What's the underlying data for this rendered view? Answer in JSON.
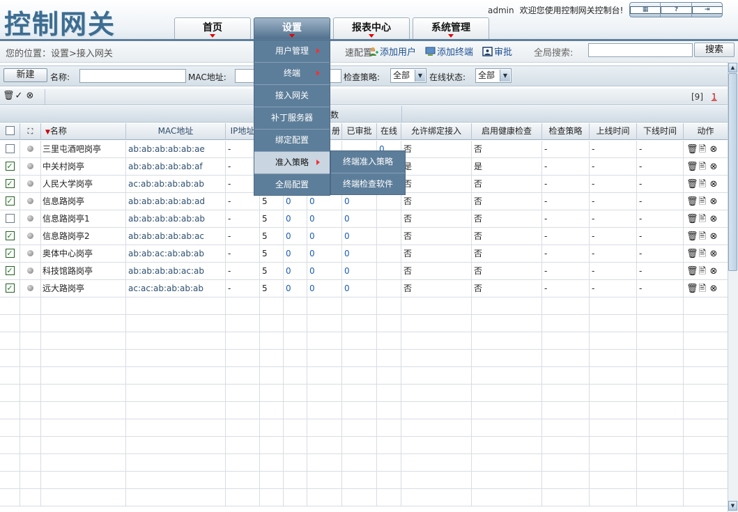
{
  "app": {
    "logo": "控制网关",
    "user": "admin",
    "welcome": "欢迎您使用控制网关控制台!"
  },
  "nav": {
    "tabs": [
      {
        "label": "首页"
      },
      {
        "label": "设置"
      },
      {
        "label": "报表中心"
      },
      {
        "label": "系统管理"
      }
    ]
  },
  "breadcrumb": "您的位置：设置>接入网关",
  "quick": {
    "label": "快速配置：",
    "label_visible": "速配置：",
    "add_user": "添加用户",
    "add_terminal": "添加终端",
    "approve": "审批"
  },
  "search": {
    "label": "全局搜索:",
    "value": "",
    "button": "搜索"
  },
  "filter": {
    "new_button": "新建",
    "name_label": "名称:",
    "mac_label": "MAC地址:",
    "check_policy_label": "检查策略:",
    "check_policy_value": "全部",
    "online_label": "在线状态:",
    "online_value": "全部"
  },
  "pager": {
    "count": "[9]",
    "page": "1"
  },
  "table": {
    "group_label": "端数",
    "columns": [
      "名称",
      "MAC地址",
      "IP地址",
      "",
      "",
      "",
      "册",
      "已审批",
      "在线",
      "允许绑定接入",
      "启用健康检查",
      "检查策略",
      "上线时间",
      "下线时间",
      "动作"
    ],
    "rows": [
      {
        "checked": false,
        "name": "三里屯酒吧岗亭",
        "mac": "ab:ab:ab:ab:ab:ae",
        "ip": "-",
        "a": "",
        "b": "",
        "c": "",
        "reg": "",
        "appr": "",
        "online": "0",
        "bind": "否",
        "health": "否",
        "policy": "-",
        "up": "-",
        "down": "-"
      },
      {
        "checked": true,
        "name": "中关村岗亭",
        "mac": "ab:ab:ab:ab:ab:af",
        "ip": "-",
        "a": "",
        "b": "",
        "c": "",
        "reg": "",
        "appr": "",
        "online": "",
        "bind": "是",
        "health": "是",
        "policy": "-",
        "up": "-",
        "down": "-"
      },
      {
        "checked": true,
        "name": "人民大学岗亭",
        "mac": "ac:ab:ab:ab:ab:ab",
        "ip": "-",
        "a": "",
        "b": "",
        "c": "",
        "reg": "",
        "appr": "",
        "online": "",
        "bind": "否",
        "health": "否",
        "policy": "-",
        "up": "-",
        "down": "-"
      },
      {
        "checked": true,
        "name": "信息路岗亭",
        "mac": "ab:ab:ab:ab:ab:ad",
        "ip": "-",
        "a": "5",
        "b": "0",
        "c": "0",
        "reg": "0",
        "appr": "0",
        "online": "",
        "bind": "否",
        "health": "否",
        "policy": "-",
        "up": "-",
        "down": "-"
      },
      {
        "checked": false,
        "name": "信息路岗亭1",
        "mac": "ab:ab:ab:ab:ab:ab",
        "ip": "-",
        "a": "5",
        "b": "0",
        "c": "0",
        "reg": "0",
        "appr": "0",
        "online": "",
        "bind": "否",
        "health": "否",
        "policy": "-",
        "up": "-",
        "down": "-"
      },
      {
        "checked": true,
        "name": "信息路岗亭2",
        "mac": "ab:ab:ab:ab:ab:ac",
        "ip": "-",
        "a": "5",
        "b": "0",
        "c": "0",
        "reg": "0",
        "appr": "0",
        "online": "",
        "bind": "否",
        "health": "否",
        "policy": "-",
        "up": "-",
        "down": "-"
      },
      {
        "checked": true,
        "name": "奥体中心岗亭",
        "mac": "ab:ab:ac:ab:ab:ab",
        "ip": "-",
        "a": "5",
        "b": "0",
        "c": "0",
        "reg": "0",
        "appr": "0",
        "online": "",
        "bind": "否",
        "health": "否",
        "policy": "-",
        "up": "-",
        "down": "-"
      },
      {
        "checked": true,
        "name": "科技馆路岗亭",
        "mac": "ab:ab:ab:ab:ac:ab",
        "ip": "-",
        "a": "5",
        "b": "0",
        "c": "0",
        "reg": "0",
        "appr": "0",
        "online": "",
        "bind": "否",
        "health": "否",
        "policy": "-",
        "up": "-",
        "down": "-"
      },
      {
        "checked": true,
        "name": "远大路岗亭",
        "mac": "ac:ac:ab:ab:ab:ab",
        "ip": "-",
        "a": "5",
        "b": "0",
        "c": "0",
        "reg": "0",
        "appr": "0",
        "online": "",
        "bind": "否",
        "health": "否",
        "policy": "-",
        "up": "-",
        "down": "-"
      }
    ]
  },
  "menu": {
    "items": [
      "用户管理",
      "终端",
      "接入网关",
      "补丁服务器",
      "绑定配置",
      "准入策略",
      "全局配置"
    ],
    "submenu": [
      "终端准入策略",
      "终端检查软件"
    ]
  }
}
